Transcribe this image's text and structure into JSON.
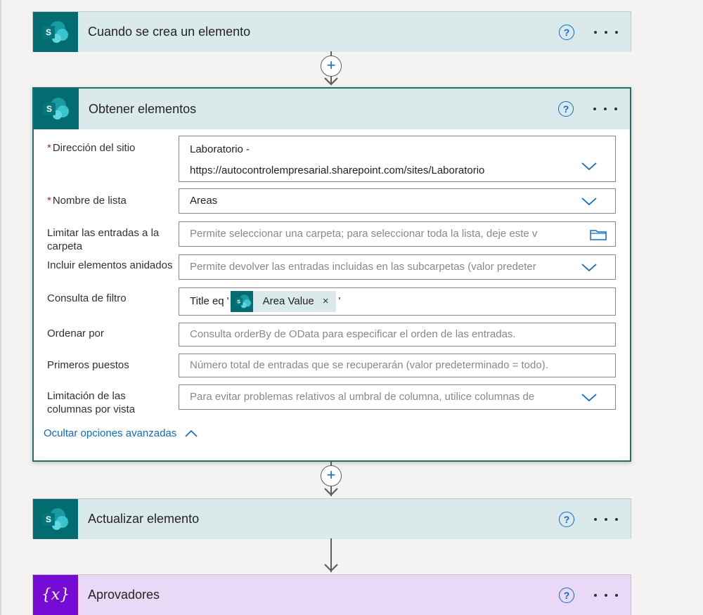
{
  "colors": {
    "sharepoint_header_bg": "#daeaeb",
    "sharepoint_icon_bg": "#036c70",
    "variable_header_bg": "#e9d9f6",
    "variable_icon_bg": "#770bd6",
    "accent_link": "#0b6ad4",
    "required_asterisk": "#a4262c",
    "expanded_border": "#1f6f6c"
  },
  "steps": {
    "trigger": {
      "title": "Cuando se crea un elemento",
      "icon": "sharepoint-icon"
    },
    "get_items": {
      "title": "Obtener elementos",
      "icon": "sharepoint-icon",
      "fields": {
        "site_address": {
          "required_mark": "*",
          "label": "Dirección del sitio",
          "value_line1": "Laboratorio -",
          "value_line2": "https://autocontrolempresarial.sharepoint.com/sites/Laboratorio"
        },
        "list_name": {
          "required_mark": "*",
          "label": "Nombre de lista",
          "value": "Areas"
        },
        "folder_limit": {
          "label": "Limitar las entradas a la carpeta",
          "placeholder": "Permite seleccionar una carpeta; para seleccionar toda la lista, deje este v"
        },
        "include_nested": {
          "label": "Incluir elementos anidados",
          "placeholder": "Permite devolver las entradas incluidas en las subcarpetas (valor predeter"
        },
        "filter_query": {
          "label": "Consulta de filtro",
          "prefix": "Title eq '",
          "token_label": "Area Value",
          "token_remove": "×",
          "suffix": "'"
        },
        "order_by": {
          "label": "Ordenar por",
          "placeholder": "Consulta orderBy de OData para especificar el orden de las entradas."
        },
        "top_count": {
          "label": "Primeros puestos",
          "placeholder": "Número total de entradas que se recuperarán (valor predeterminado = todo)."
        },
        "column_limit": {
          "label": "Limitación de las columnas por vista",
          "placeholder": "Para evitar problemas relativos al umbral de columna, utilice columnas de"
        }
      },
      "advanced_toggle": "Ocultar opciones avanzadas"
    },
    "update_item": {
      "title": "Actualizar elemento",
      "icon": "sharepoint-icon"
    },
    "approvers": {
      "title": "Aprovadores",
      "icon": "variable-icon",
      "icon_text": "{x}"
    }
  },
  "common": {
    "help_symbol": "?",
    "add_symbol": "+"
  }
}
